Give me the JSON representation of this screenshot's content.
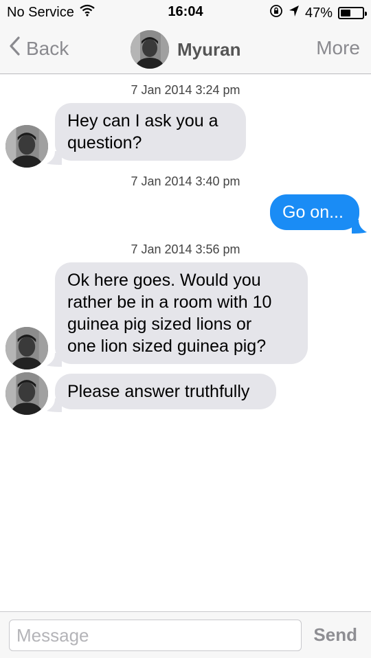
{
  "status_bar": {
    "carrier": "No Service",
    "time": "16:04",
    "battery_percent": "47%",
    "battery_level": 0.47,
    "icons": [
      "wifi-icon",
      "moon-icon",
      "rotation-lock-icon",
      "location-arrow-icon",
      "battery-icon"
    ]
  },
  "nav": {
    "back_label": "Back",
    "contact_name": "Myuran",
    "more_label": "More"
  },
  "conversation": {
    "timestamps": [
      "7 Jan 2014 3:24 pm",
      "7 Jan 2014 3:40 pm",
      "7 Jan 2014 3:56 pm"
    ],
    "messages": [
      {
        "direction": "incoming",
        "lines": [
          "Hey can I ask you a",
          "question?"
        ]
      },
      {
        "direction": "outgoing",
        "lines": [
          "Go on..."
        ]
      },
      {
        "direction": "incoming",
        "lines": [
          "Ok here goes. Would you",
          "rather be in a room with 10",
          "guinea pig sized lions or",
          "one lion sized guinea pig?"
        ]
      },
      {
        "direction": "incoming",
        "lines": [
          "Please answer truthfully"
        ]
      }
    ]
  },
  "input": {
    "placeholder": "Message",
    "send_label": "Send"
  },
  "colors": {
    "outgoing_bubble": "#1a8cf5",
    "incoming_bubble": "#e5e5ea",
    "bar_background": "#f7f7f7"
  }
}
